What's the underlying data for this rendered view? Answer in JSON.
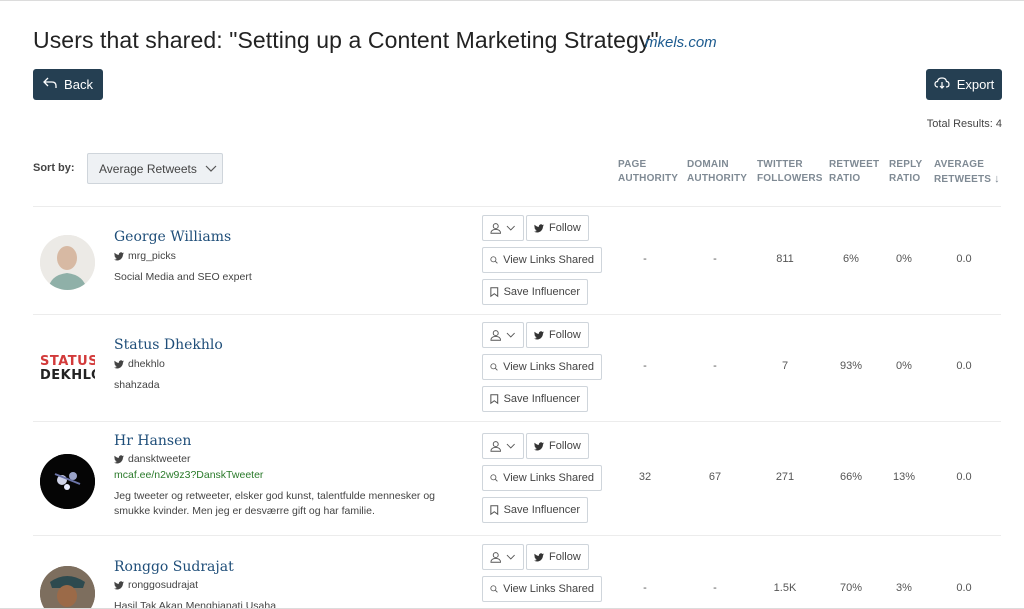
{
  "header": {
    "title": "Users that shared: \"Setting up a Content Marketing Strategy\"",
    "domain": "mkels.com",
    "back_label": "Back",
    "export_label": "Export",
    "total_results": "Total Results: 4"
  },
  "sort": {
    "label": "Sort by:",
    "value": "Average Retweets"
  },
  "columns": {
    "page_authority": [
      "PAGE",
      "AUTHORITY"
    ],
    "domain_authority": [
      "DOMAIN",
      "AUTHORITY"
    ],
    "twitter_followers": [
      "TWITTER",
      "FOLLOWERS"
    ],
    "retweet_ratio": [
      "RETWEET",
      "RATIO"
    ],
    "reply_ratio": [
      "REPLY",
      "RATIO"
    ],
    "average_retweets": [
      "AVERAGE",
      "RETWEETS"
    ]
  },
  "actions": {
    "follow": "Follow",
    "view_links": "View Links Shared",
    "save": "Save Influencer"
  },
  "users": [
    {
      "name": "George Williams",
      "handle": "mrg_picks",
      "url": "",
      "bio": "Social Media and SEO expert",
      "page_authority": "-",
      "domain_authority": "-",
      "followers": "811",
      "retweet_ratio": "6%",
      "reply_ratio": "0%",
      "avg_retweets": "0.0"
    },
    {
      "name": "Status Dhekhlo",
      "handle": "dhekhlo",
      "url": "",
      "bio": "shahzada",
      "avatar_text": [
        "STATUS",
        "DEKHLO"
      ],
      "page_authority": "-",
      "domain_authority": "-",
      "followers": "7",
      "retweet_ratio": "93%",
      "reply_ratio": "0%",
      "avg_retweets": "0.0"
    },
    {
      "name": "Hr Hansen",
      "handle": "dansktweeter",
      "url": "mcaf.ee/n2w9z3?DanskTweeter",
      "bio": "Jeg tweeter og retweeter, elsker god kunst, talentfulde mennesker og smukke kvinder. Men jeg er desværre gift og har familie.",
      "page_authority": "32",
      "domain_authority": "67",
      "followers": "271",
      "retweet_ratio": "66%",
      "reply_ratio": "13%",
      "avg_retweets": "0.0"
    },
    {
      "name": "Ronggo Sudrajat",
      "handle": "ronggosudrajat",
      "url": "",
      "bio": "Hasil Tak Akan Menghianati Usaha",
      "page_authority": "-",
      "domain_authority": "-",
      "followers": "1.5K",
      "retweet_ratio": "70%",
      "reply_ratio": "3%",
      "avg_retweets": "0.0"
    }
  ],
  "colors": {
    "dark_button": "#253f52",
    "name_link": "#1f4e79",
    "url_green": "#2a7a2a",
    "status_red": "#d23a3a"
  }
}
